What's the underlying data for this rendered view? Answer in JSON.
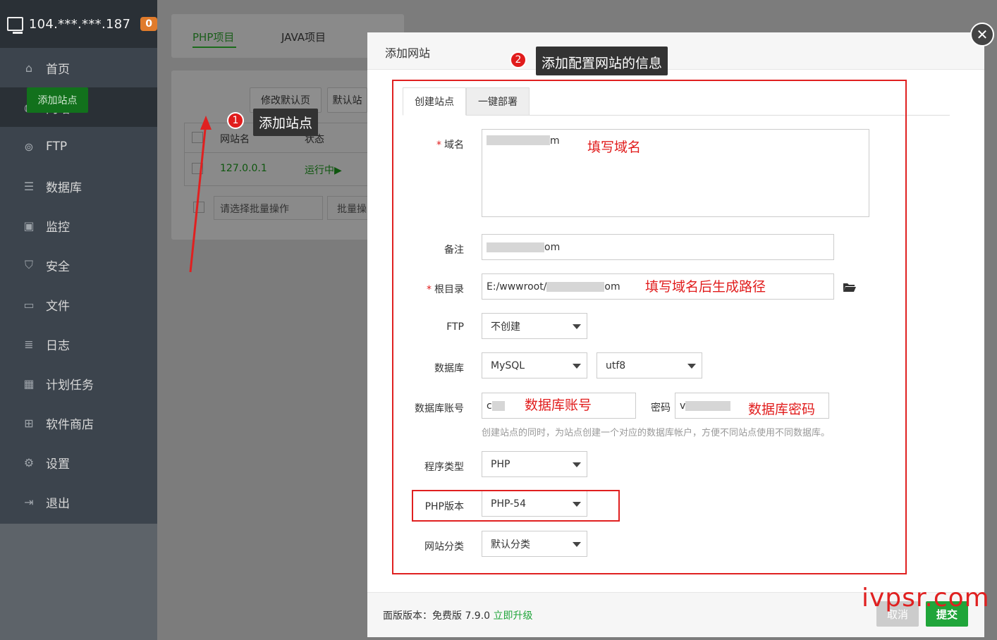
{
  "server": {
    "ip": "104.***.***.187",
    "badge": "0"
  },
  "sidebar": {
    "items": [
      {
        "label": "首页",
        "icon": "home-icon"
      },
      {
        "label": "网站",
        "icon": "globe-icon"
      },
      {
        "label": "FTP",
        "icon": "ftp-icon"
      },
      {
        "label": "数据库",
        "icon": "database-icon"
      },
      {
        "label": "监控",
        "icon": "monitor-icon"
      },
      {
        "label": "安全",
        "icon": "shield-icon"
      },
      {
        "label": "文件",
        "icon": "folder-icon"
      },
      {
        "label": "日志",
        "icon": "log-icon"
      },
      {
        "label": "计划任务",
        "icon": "calendar-icon"
      },
      {
        "label": "软件商店",
        "icon": "apps-icon"
      },
      {
        "label": "设置",
        "icon": "gear-icon"
      },
      {
        "label": "退出",
        "icon": "logout-icon"
      }
    ]
  },
  "tabs": {
    "php": "PHP项目",
    "java": "JAVA项目"
  },
  "toolbar": {
    "add": "添加站点",
    "modify": "修改默认页",
    "default": "默认站"
  },
  "table": {
    "col_name": "网站名",
    "col_status": "状态",
    "row_name": "127.0.0.1",
    "row_status": "运行中▶"
  },
  "batch": {
    "placeholder": "请选择批量操作",
    "btn": "批量操"
  },
  "annotations": {
    "step1": "添加站点",
    "step1_num": "1",
    "step2": "添加配置网站的信息",
    "step2_num": "2"
  },
  "modal": {
    "title": "添加网站",
    "tab_create": "创建站点",
    "tab_deploy": "一键部署",
    "domain_label": "域名",
    "domain_value_suffix": "m",
    "domain_note": "填写域名",
    "remark_label": "备注",
    "remark_value_suffix": "om",
    "root_label": "根目录",
    "root_value_prefix": "E:/wwwroot/",
    "root_value_suffix": "om",
    "root_note": "填写域名后生成路径",
    "ftp_label": "FTP",
    "ftp_value": "不创建",
    "db_label": "数据库",
    "db_type": "MySQL",
    "db_charset": "utf8",
    "db_account_label": "数据库账号",
    "db_account_prefix": "c",
    "db_account_note": "数据库账号",
    "pwd_label": "密码",
    "pwd_prefix": "v",
    "pwd_note": "数据库密码",
    "db_hint": "创建站点的同时，为站点创建一个对应的数据库帐户，方便不同站点使用不同数据库。",
    "prog_label": "程序类型",
    "prog_value": "PHP",
    "php_label": "PHP版本",
    "php_value": "PHP-54",
    "cat_label": "网站分类",
    "cat_value": "默认分类"
  },
  "footer": {
    "version": "面版版本：免费版 7.9.0",
    "upgrade": "立即升级",
    "cancel": "取消",
    "submit": "提交"
  },
  "watermark": "ivpsr.com"
}
